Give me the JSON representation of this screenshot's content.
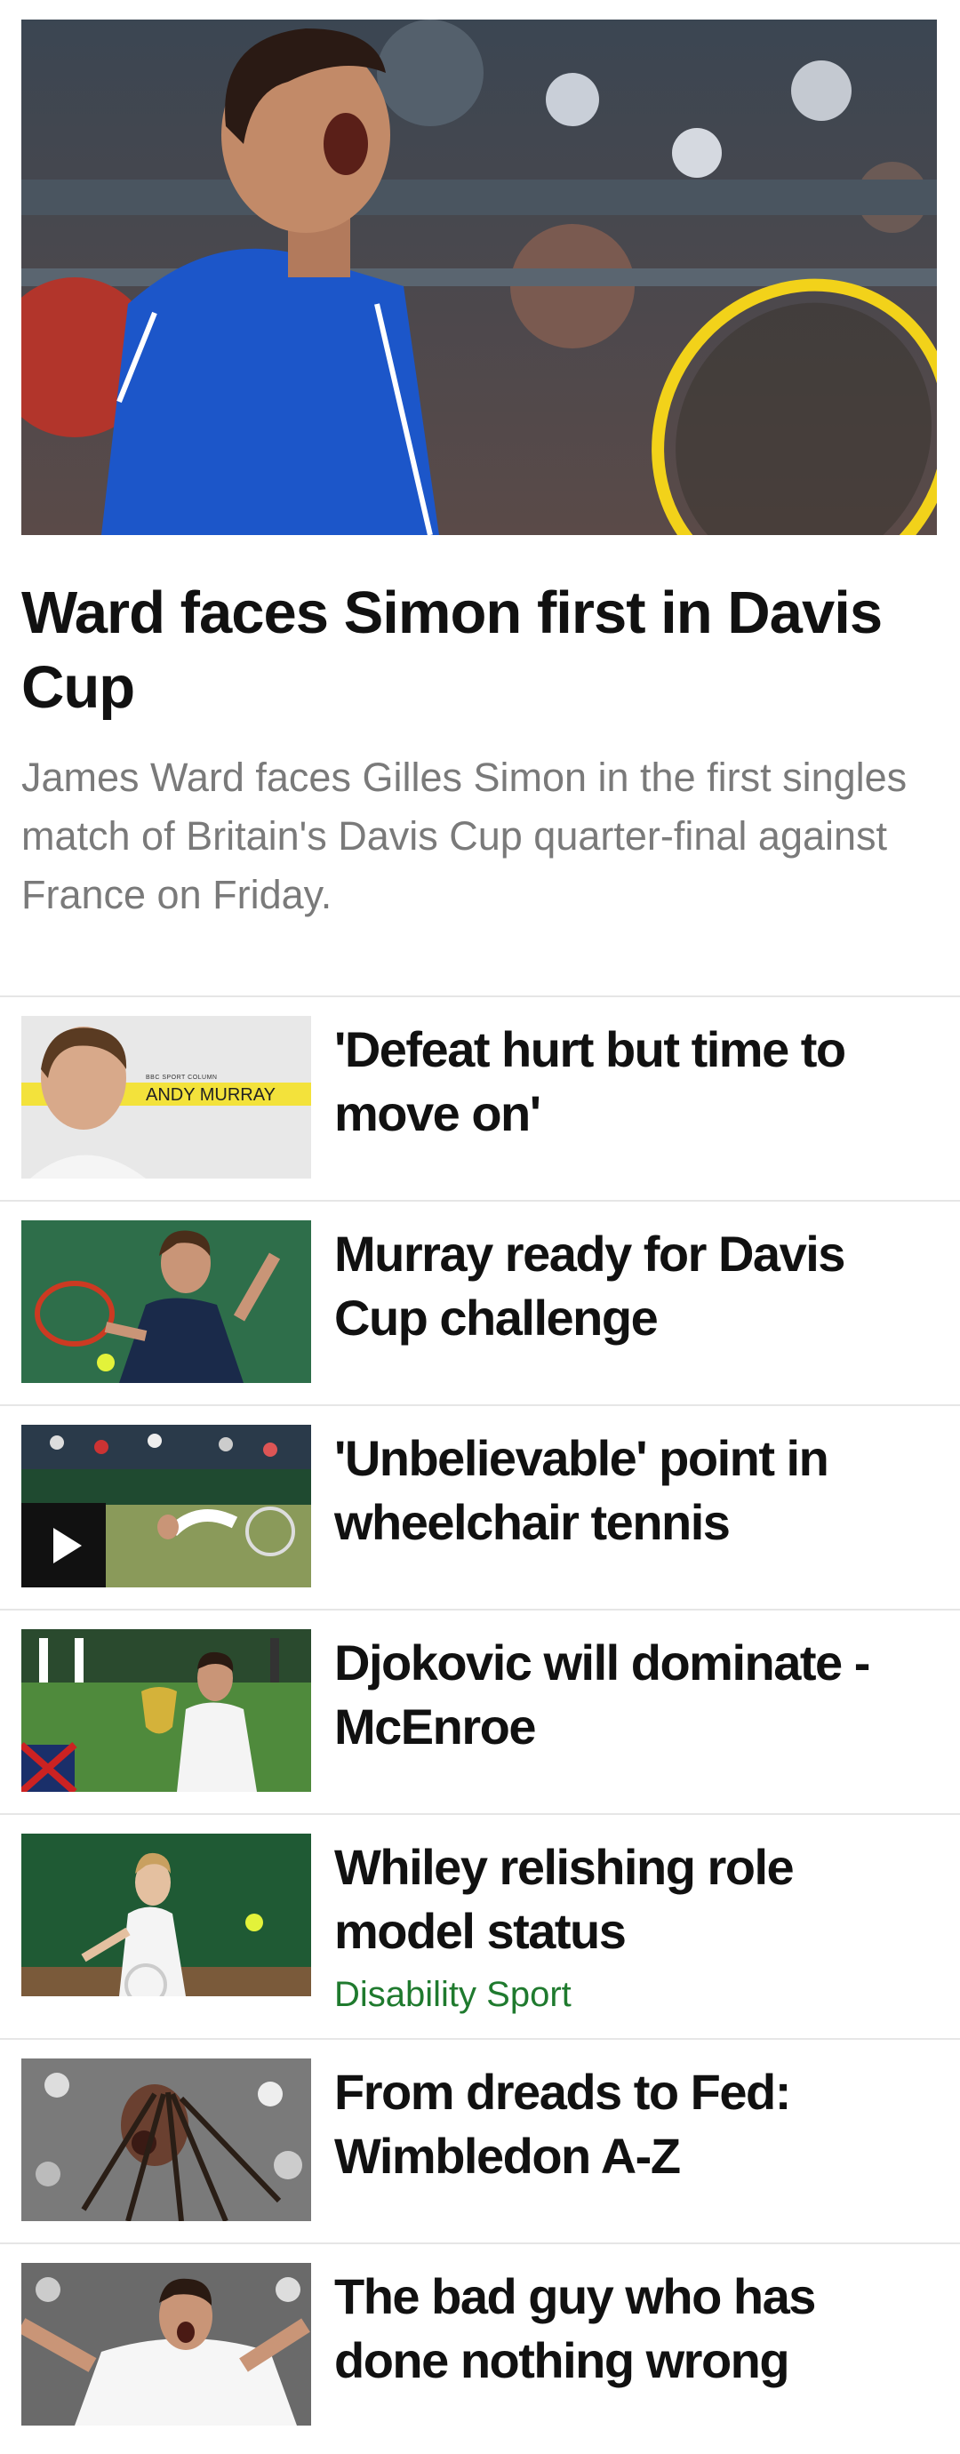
{
  "hero": {
    "title": "Ward faces Simon first in Davis Cup",
    "summary": "James Ward faces Gilles Simon in the first singles match of Britain's Davis Cup quarter-final against France on Friday."
  },
  "stories": [
    {
      "title": "'Defeat hurt but time to move on'",
      "thumb_caption_small": "BBC SPORT COLUMN",
      "thumb_caption": "ANDY MURRAY"
    },
    {
      "title": "Murray ready for Davis Cup challenge"
    },
    {
      "title": "'Unbelievable' point in wheelchair tennis",
      "media": "video"
    },
    {
      "title": "Djokovic will dominate - McEnroe"
    },
    {
      "title": "Whiley relishing role model status",
      "tag": "Disability Sport"
    },
    {
      "title": "From dreads to Fed: Wimbledon A-Z"
    },
    {
      "title": "The bad guy who has done nothing wrong"
    }
  ],
  "colors": {
    "tag": "#1f7a2e",
    "divider": "#e6e6e6",
    "summary": "#7a7a7a"
  }
}
